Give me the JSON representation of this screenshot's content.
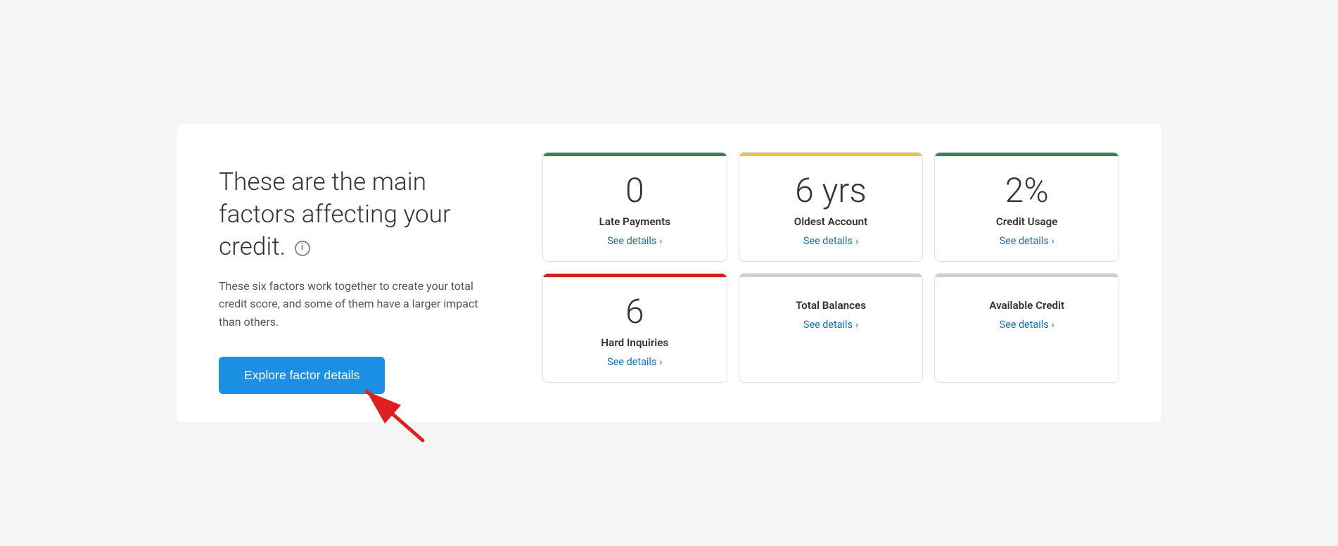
{
  "left": {
    "heading": "These are the main factors affecting your credit.",
    "description": "These six factors work together to create your total credit score, and some of them have a larger impact than others.",
    "explore_button": "Explore factor details",
    "info_icon_label": "i"
  },
  "cards": [
    {
      "value": "0",
      "label": "Late Payments",
      "link_text": "See details",
      "color_class": "green",
      "id": "late-payments"
    },
    {
      "value": "6 yrs",
      "label": "Oldest Account",
      "link_text": "See details",
      "color_class": "yellow",
      "id": "oldest-account"
    },
    {
      "value": "2%",
      "label": "Credit Usage",
      "link_text": "See details",
      "color_class": "green2",
      "id": "credit-usage"
    },
    {
      "value": "6",
      "label": "Hard Inquiries",
      "link_text": "See details",
      "color_class": "red",
      "id": "hard-inquiries"
    },
    {
      "value": "",
      "label": "Total Balances",
      "link_text": "See details",
      "color_class": "gray",
      "id": "total-balances"
    },
    {
      "value": "",
      "label": "Available Credit",
      "link_text": "See details",
      "color_class": "gray2",
      "id": "available-credit"
    }
  ],
  "chevron": "›"
}
